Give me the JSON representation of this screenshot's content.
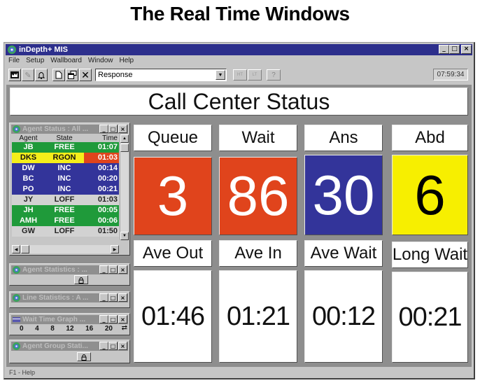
{
  "page_title": "The Real Time Windows",
  "app": {
    "title": "inDepth+ MIS",
    "window_buttons": {
      "minimize": "_",
      "maximize": "□",
      "close": "×"
    },
    "menu": [
      "File",
      "Setup",
      "Wallboard",
      "Window",
      "Help"
    ],
    "toolbar": {
      "icons": [
        "wallboard-icon",
        "wrench-icon",
        "bell-icon",
        "new-document-icon",
        "cascade-windows-icon",
        "close-x-icon"
      ],
      "combo_value": "Response",
      "small_buttons": [
        "HT",
        "LT",
        "?"
      ],
      "clock": "07:59:34"
    },
    "status_bar": "F1 - Help"
  },
  "banner": "Call Center Status",
  "agent_status": {
    "title": "Agent Status : All ...",
    "columns": [
      "Agent",
      "State",
      "Time"
    ],
    "rows": [
      {
        "agent": "JB",
        "state": "FREE",
        "time": "01:07",
        "bg": "#1f9a3a",
        "fg": "#ffffff",
        "time_bg": "#1f9a3a"
      },
      {
        "agent": "DKS",
        "state": "RGON",
        "time": "01:03",
        "bg": "#f5ee1a",
        "fg": "#111111",
        "time_bg": "#e0441c",
        "time_fg": "#ffffff"
      },
      {
        "agent": "DW",
        "state": "INC",
        "time": "00:14",
        "bg": "#33349a",
        "fg": "#ffffff",
        "time_bg": "#33349a"
      },
      {
        "agent": "BC",
        "state": "INC",
        "time": "00:20",
        "bg": "#33349a",
        "fg": "#ffffff",
        "time_bg": "#33349a"
      },
      {
        "agent": "PO",
        "state": "INC",
        "time": "00:21",
        "bg": "#33349a",
        "fg": "#ffffff",
        "time_bg": "#33349a"
      },
      {
        "agent": "JY",
        "state": "LOFF",
        "time": "01:03",
        "bg": "#d2d2d2",
        "fg": "#222222",
        "time_bg": "#d2d2d2"
      },
      {
        "agent": "JH",
        "state": "FREE",
        "time": "00:05",
        "bg": "#1f9a3a",
        "fg": "#ffffff",
        "time_bg": "#1f9a3a"
      },
      {
        "agent": "AMH",
        "state": "FREE",
        "time": "00:06",
        "bg": "#1f9a3a",
        "fg": "#ffffff",
        "time_bg": "#1f9a3a"
      },
      {
        "agent": "GW",
        "state": "LOFF",
        "time": "01:50",
        "bg": "#d2d2d2",
        "fg": "#222222",
        "time_bg": "#d2d2d2"
      }
    ]
  },
  "minimized_windows": [
    {
      "title": "Agent Statistics : ..."
    },
    {
      "title": "Line Statistics : A ..."
    },
    {
      "title": "Wait Time Graph ...",
      "scale": [
        "0",
        "4",
        "8",
        "12",
        "16",
        "20"
      ]
    },
    {
      "title": "Agent Group Stati..."
    }
  ],
  "metrics": [
    {
      "label": "Queue",
      "value": "3",
      "bg": "#e0441c",
      "fg": "#ffffff"
    },
    {
      "label": "Wait",
      "value": "86",
      "bg": "#e0441c",
      "fg": "#ffffff"
    },
    {
      "label": "Ans",
      "value": "30",
      "bg": "#33349a",
      "fg": "#ffffff"
    },
    {
      "label": "Abd",
      "value": "6",
      "bg": "#f7ef00",
      "fg": "#000000"
    }
  ],
  "times": [
    {
      "label": "Ave Out",
      "value": "01:46"
    },
    {
      "label": "Ave In",
      "value": "01:21"
    },
    {
      "label": "Ave Wait",
      "value": "00:12"
    },
    {
      "label": "Long Wait",
      "value": "00:21"
    }
  ]
}
